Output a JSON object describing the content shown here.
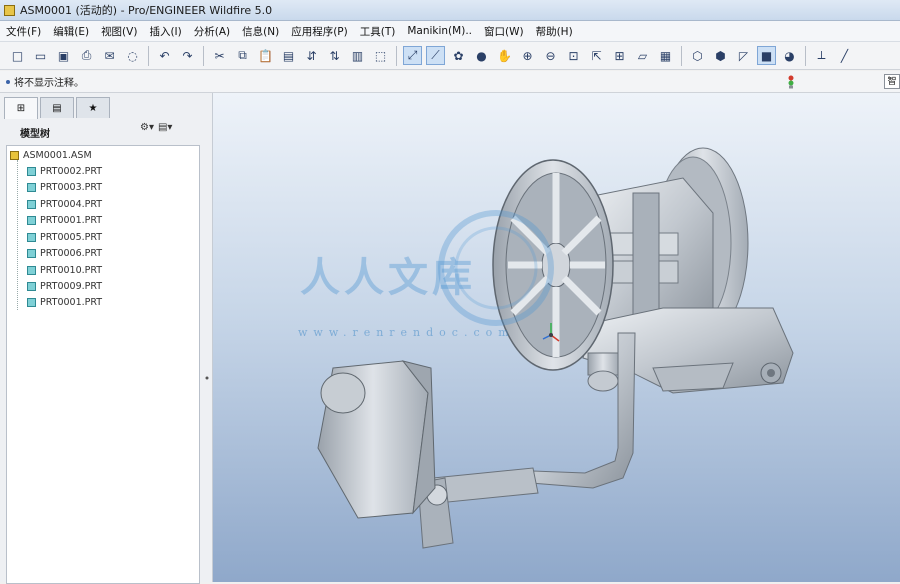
{
  "window": {
    "title": "ASM0001 (活动的) - Pro/ENGINEER Wildfire 5.0"
  },
  "menu": [
    "文件(F)",
    "编辑(E)",
    "视图(V)",
    "插入(I)",
    "分析(A)",
    "信息(N)",
    "应用程序(P)",
    "工具(T)",
    "Manikin(M)..",
    "窗口(W)",
    "帮助(H)"
  ],
  "status": {
    "message": "将不显示注释。"
  },
  "panel": {
    "title": "模型树"
  },
  "tree": {
    "root": "ASM0001.ASM",
    "items": [
      "PRT0002.PRT",
      "PRT0003.PRT",
      "PRT0004.PRT",
      "PRT0001.PRT",
      "PRT0005.PRT",
      "PRT0006.PRT",
      "PRT0010.PRT",
      "PRT0009.PRT",
      "PRT0001.PRT"
    ]
  },
  "watermark": {
    "text": "人人文库",
    "url": "www.renrendoc.com"
  },
  "colors": {
    "viewport_top": "#eef3f9",
    "viewport_bottom": "#8fa8ca",
    "part": "#c2c8cf"
  }
}
